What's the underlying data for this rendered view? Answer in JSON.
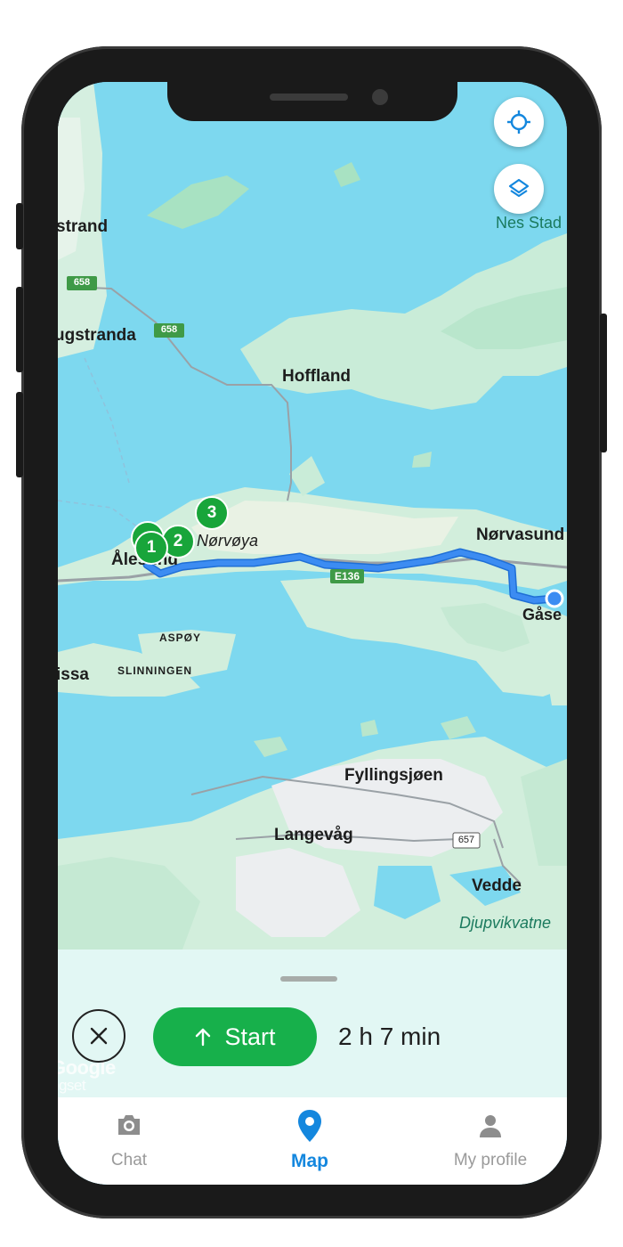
{
  "map": {
    "places": {
      "strand": "strand",
      "haugstranda": "ugstranda",
      "nes_stad": "Nes Stad",
      "hoffland": "Hoffland",
      "norvoya": "Nørvøya",
      "norvasund": "Nørvasund",
      "alesund": "Ålesund",
      "gaser": "Gåse",
      "aspoy": "ASPØY",
      "slinningen": "SLINNINGEN",
      "issa": "issa",
      "fyllingsjoen": "Fyllingsjøen",
      "langevag": "Langevåg",
      "vedde": "Vedde",
      "djupvikvatnet": "Djupvikvatne"
    },
    "roads": {
      "r658": "658",
      "e136": "E136",
      "r657": "657"
    },
    "pins": [
      "1",
      "2",
      "3"
    ],
    "colors": {
      "water": "#7dd8ef",
      "land": "#cfeedd",
      "route": "#3c8cf2",
      "pin": "#18a53a"
    }
  },
  "controls": {
    "locate_icon": "crosshair-icon",
    "layers_icon": "layers-icon"
  },
  "sheet": {
    "close_icon": "close-icon",
    "start_label": "Start",
    "start_icon": "arrow-up-icon",
    "eta": "2 h 7 min",
    "attribution": "Google",
    "attribution_sub": "ngset"
  },
  "tabs": [
    {
      "label": "Chat",
      "icon": "camera-icon",
      "active": false
    },
    {
      "label": "Map",
      "icon": "map-pin-icon",
      "active": true
    },
    {
      "label": "My profile",
      "icon": "person-icon",
      "active": false
    }
  ],
  "brand": {
    "accent": "#1487de",
    "start": "#17b04b"
  }
}
